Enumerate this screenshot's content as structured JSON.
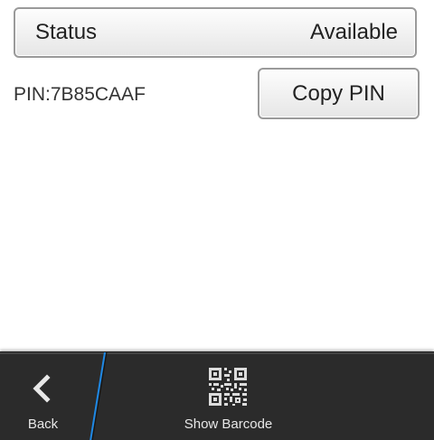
{
  "status": {
    "label": "Status",
    "value": "Available"
  },
  "pin": {
    "text": "PIN:7B85CAAF",
    "copy_label": "Copy PIN"
  },
  "action_bar": {
    "back_label": "Back",
    "back_icon": "chevron-left-icon",
    "barcode_label": "Show Barcode",
    "barcode_icon": "qr-code-icon",
    "divider_color": "#1e88e5"
  }
}
